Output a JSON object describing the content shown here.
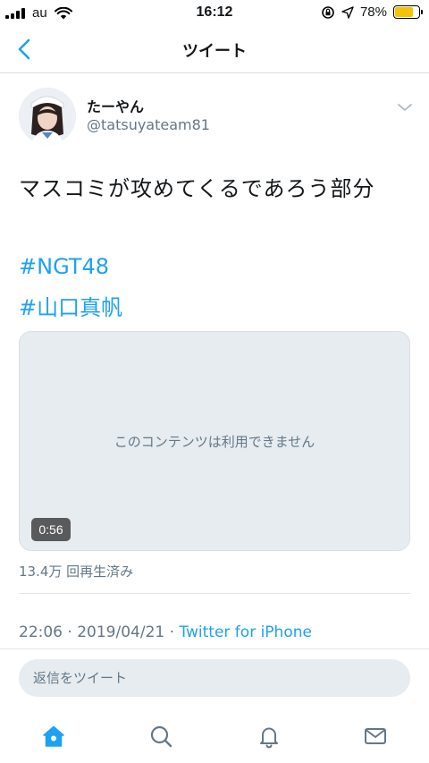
{
  "status_bar": {
    "carrier": "au",
    "time": "16:12",
    "battery_percent": "78%",
    "battery_level": 0.78,
    "battery_color": "#f5c400"
  },
  "nav": {
    "back_icon": "chevron-left-icon",
    "title": "ツイート"
  },
  "tweet": {
    "author_name": "たーやん",
    "author_handle": "@tatsuyateam81",
    "more_icon": "chevron-down-icon",
    "text": "マスコミが攻めてくるであろう部分",
    "hashtags": [
      "#NGT48",
      "#山口真帆"
    ],
    "media": {
      "unavailable_message": "このコンテンツは利用できません",
      "duration": "0:56"
    },
    "views": "13.4万 回再生済み",
    "time": "22:06",
    "date": "2019/04/21",
    "separator": " · ",
    "source": "Twitter for iPhone"
  },
  "reply": {
    "placeholder": "返信をツイート"
  },
  "tabbar": {
    "items": [
      {
        "icon": "home-icon",
        "active": true
      },
      {
        "icon": "search-icon",
        "active": false
      },
      {
        "icon": "bell-icon",
        "active": false
      },
      {
        "icon": "mail-icon",
        "active": false
      }
    ]
  },
  "colors": {
    "accent": "#1da1f2",
    "secondary_text": "#657786",
    "media_bg": "#e6ecf0"
  }
}
